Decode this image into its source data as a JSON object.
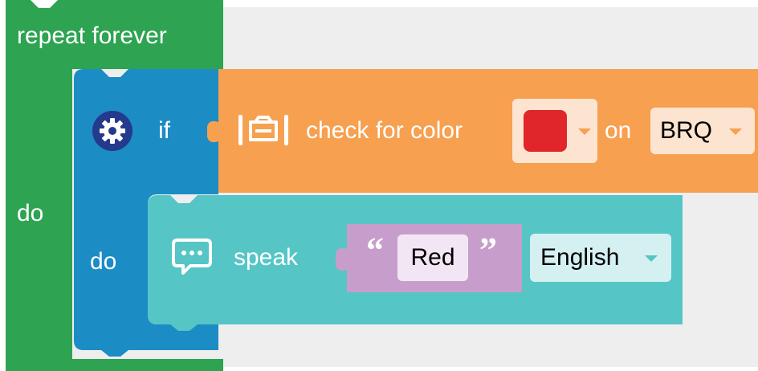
{
  "colors": {
    "workspace": "#eeeeee",
    "control_green": "#2ea352",
    "if_blue": "#1b8cc4",
    "sensor_orange": "#f6a050",
    "speak_teal": "#55c5c6",
    "string_purple": "#c79ecb",
    "color_red": "#e0252b"
  },
  "repeat_block": {
    "title": "repeat forever",
    "do_label": "do"
  },
  "if_block": {
    "gear_icon": "gear-icon",
    "if_label": "if",
    "do_label": "do"
  },
  "condition_block": {
    "sensor_icon": "color-sensor-icon",
    "label": "check for color",
    "color_value": "#e0252b",
    "on_label": "on",
    "port_value": "BRQ"
  },
  "speak_block": {
    "speech_icon": "speech-bubble-icon",
    "label": "speak",
    "text_value": "Red",
    "open_quote": "“",
    "close_quote": "”",
    "language_value": "English"
  }
}
